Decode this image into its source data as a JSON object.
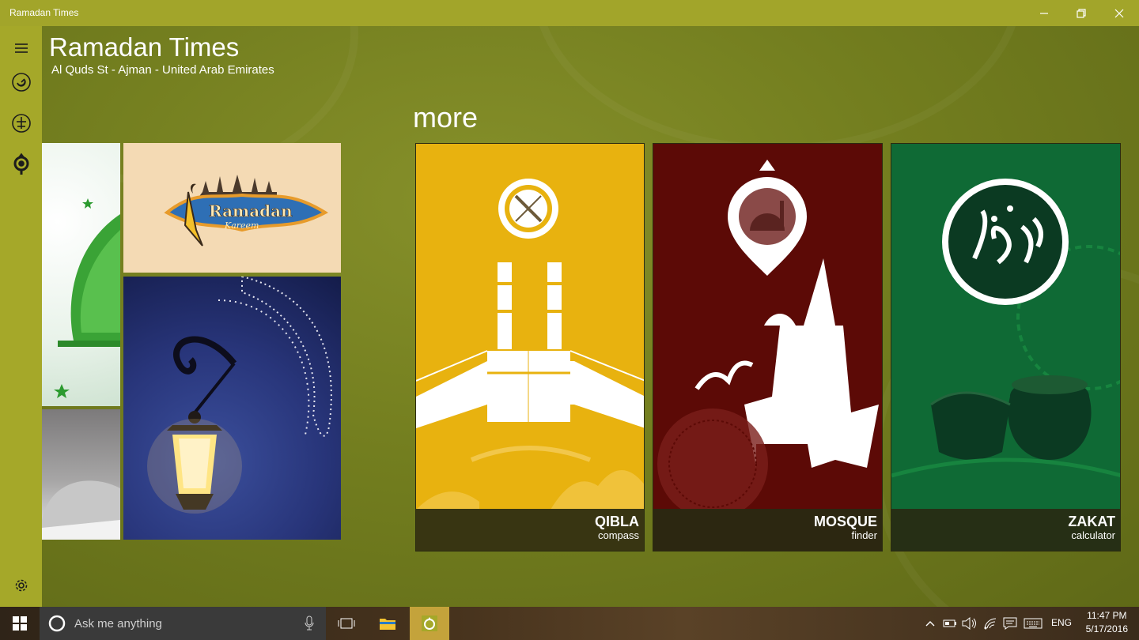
{
  "window": {
    "title": "Ramadan Times",
    "controls": {
      "minimize": "minimize-icon",
      "restore": "restore-icon",
      "close": "close-icon"
    }
  },
  "rail": {
    "items": [
      {
        "name": "menu",
        "icon": "hamburger-icon"
      },
      {
        "name": "prayer-times",
        "icon": "clock-crescent-icon"
      },
      {
        "name": "calendar",
        "icon": "crescent-calendar-icon"
      },
      {
        "name": "qibla",
        "icon": "compass-pin-icon"
      }
    ],
    "settings_icon": "gear-icon"
  },
  "header": {
    "title": "Ramadan Times",
    "location": "Al Quds St - Ajman - United Arab Emirates"
  },
  "section": {
    "heading": "more"
  },
  "tiles": [
    {
      "id": "qibla",
      "main": "QIBLA",
      "sub": "compass",
      "color": "#e8b20f"
    },
    {
      "id": "mosque",
      "main": "MOSQUE",
      "sub": "finder",
      "color": "#5c0a06"
    },
    {
      "id": "zakat",
      "main": "ZAKAT",
      "sub": "calculator",
      "color": "#0f6a35"
    }
  ],
  "photos": {
    "banner_text": "Ramadan",
    "banner_sub": "Kareem"
  },
  "taskbar": {
    "search_placeholder": "Ask me anything",
    "language": "ENG",
    "time": "11:47 PM",
    "date": "5/17/2016"
  },
  "colors": {
    "titlebar": "#a2a52a",
    "rail": "#a5a829",
    "background": "#737e1f"
  }
}
